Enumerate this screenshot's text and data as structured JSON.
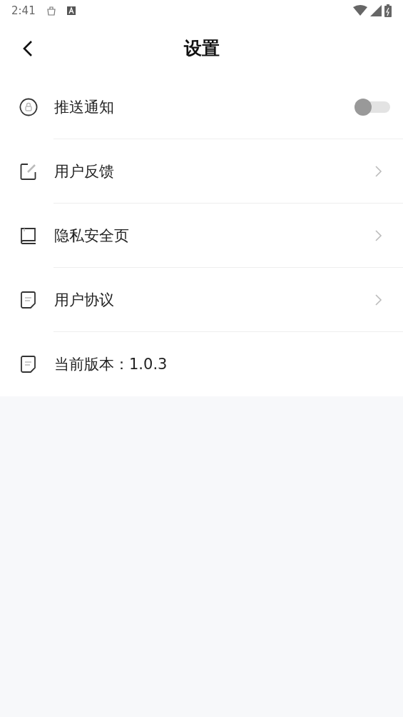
{
  "status_bar": {
    "time": "2:41"
  },
  "header": {
    "title": "设置"
  },
  "rows": [
    {
      "kind": "toggle",
      "label": "推送通知",
      "on": false
    },
    {
      "kind": "link",
      "label": "用户反馈"
    },
    {
      "kind": "link",
      "label": "隐私安全页"
    },
    {
      "kind": "link",
      "label": "用户协议"
    },
    {
      "kind": "info",
      "label": "当前版本：1.0.3"
    }
  ]
}
